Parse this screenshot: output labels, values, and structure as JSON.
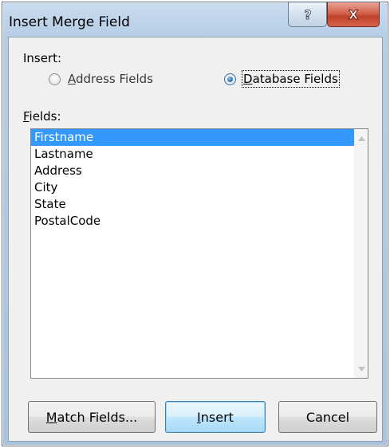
{
  "window": {
    "title": "Insert Merge Field",
    "help_glyph": "?",
    "close_glyph": "X"
  },
  "insert_group": {
    "label_prefix": "Insert:",
    "options": [
      {
        "accel": "A",
        "rest": "ddress Fields",
        "checked": false
      },
      {
        "accel": "D",
        "rest": "atabase Fields",
        "checked": true
      }
    ]
  },
  "fields": {
    "label_accel": "F",
    "label_rest": "ields:",
    "items": [
      "Firstname",
      "Lastname",
      "Address",
      "City",
      "State",
      "PostalCode"
    ],
    "selected_index": 0
  },
  "buttons": {
    "match_accel": "M",
    "match_rest": "atch Fields...",
    "insert_accel": "I",
    "insert_rest": "nsert",
    "cancel_label": "Cancel"
  },
  "colors": {
    "selection": "#3399ff",
    "close_button": "#c7432c",
    "title_bar": "#b6cde6"
  },
  "icons": {
    "help": "help-icon",
    "close": "close-icon",
    "scroll_up": "scroll-up-arrow-icon",
    "scroll_down": "scroll-down-arrow-icon"
  }
}
